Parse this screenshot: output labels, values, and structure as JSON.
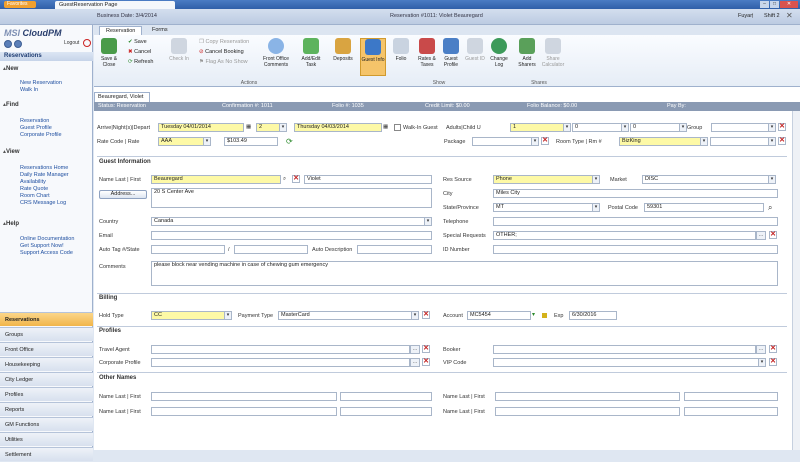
{
  "titlebar": {
    "favorites": "Favorites",
    "tab": "GuestReservation Page"
  },
  "header": {
    "business_date": "Business Date: 3/4/2014",
    "reservation_title": "Reservation #1011: Violet Beauregard",
    "user": "Fuyan",
    "shift": "Shift 2"
  },
  "sidebar": {
    "logo_a": "MSI",
    "logo_b": "CloudPM",
    "logout": "Logout",
    "panel_title": "Reservations",
    "sections": [
      {
        "title": "New",
        "items": [
          "New Reservation",
          "Walk In"
        ]
      },
      {
        "title": "Find",
        "items": [
          "Reservation",
          "Guest Profile",
          "Corporate Profile"
        ]
      },
      {
        "title": "View",
        "items": [
          "Reservations Home",
          "Daily Rate Manager",
          "Availability",
          "Rate Quote",
          "Room Chart",
          "CRS Message Log"
        ]
      },
      {
        "title": "Help",
        "items": [
          "Online Documentation",
          "Get Support Now!",
          "Support Access Code"
        ]
      }
    ],
    "bottom": [
      "Reservations",
      "Groups",
      "Front Office",
      "Housekeeping",
      "City Ledger",
      "Profiles",
      "Reports",
      "GM Functions",
      "Utilities",
      "Settlement"
    ]
  },
  "ribbon": {
    "tabs": [
      "Reservation",
      "Forms"
    ],
    "save_close": "Save & Close",
    "save": "Save",
    "cancel": "Cancel",
    "refresh": "Refresh",
    "check_in": "Check In",
    "copy_res": "Copy Reservation",
    "cancel_booking": "Cancel Booking",
    "flag_no_show": "Flag As No Show",
    "front_office_comments": "Front Office Comments",
    "add_edit_task": "Add/Edit Task",
    "deposits": "Deposits",
    "guest_info": "Guest Info",
    "folio": "Folio",
    "rates_taxes": "Rates & Taxes",
    "guest_profile": "Guest Profile",
    "guest_id": "Guest ID",
    "change_log": "Change Log",
    "add_sharers": "Add Sharers",
    "share_calculator": "Share Calculator",
    "groups": [
      "Actions",
      "Show",
      "Shares"
    ]
  },
  "doc_tab": "Beauregard, Violet",
  "status": {
    "status": "Status: Reservation",
    "confirmation": "Confirmation #: 1011",
    "folio": "Folio #: 1035",
    "credit_limit": "Credit Limit: $0.00",
    "folio_balance": "Folio Balance: $0.00",
    "pay_by": "Pay By:"
  },
  "stay": {
    "arrive_label": "Arrive|Night(s)|Depart",
    "arrive": "Tuesday 04/01/2014",
    "nights": "2",
    "depart": "Thursday 04/03/2014",
    "walkin_label": "Walk-In Guest",
    "adults_label": "Adults|Child U",
    "adults": "1",
    "child_a": "0",
    "child_b": "0",
    "group_label": "Group",
    "rate_label": "Rate Code | Rate",
    "rate_code": "AAA",
    "rate": "$103.49",
    "package_label": "Package",
    "room_label": "Room Type | Rm #",
    "room_type": "BizKing"
  },
  "guest": {
    "section": "Guest Information",
    "name_label": "Name  Last | First",
    "last": "Beauregard",
    "first": "Violet",
    "address_btn": "Address...",
    "address": "20 S Center Ave",
    "country_label": "Country",
    "country": "Canada",
    "email_label": "Email",
    "autotag_label": "Auto Tag #/State",
    "auto_desc_label": "Auto Description",
    "comments_label": "Comments",
    "comments": "please block near vending machine in case of chewing gum emergency",
    "res_source_label": "Res Source",
    "res_source": "Phone",
    "market_label": "Market",
    "market": "DISC",
    "city_label": "City",
    "city": "Miles City",
    "state_label": "State/Province",
    "state": "MT",
    "postal_label": "Postal Code",
    "postal": "59301",
    "telephone_label": "Telephone",
    "special_label": "Special Requests",
    "special": "OTHER;",
    "id_label": "ID Number"
  },
  "billing": {
    "section": "Billing",
    "hold_label": "Hold Type",
    "hold": "CC",
    "payment_label": "Payment Type",
    "payment": "MasterCard",
    "account_label": "Account",
    "account": "MC5454",
    "exp_label": "Exp",
    "exp": "6/30/2016"
  },
  "profiles": {
    "section": "Profiles",
    "travel_agent": "Travel Agent",
    "corporate": "Corporate Profile",
    "booker": "Booker",
    "vip": "VIP Code"
  },
  "other_names": {
    "section": "Other Names",
    "name_label": "Name  Last | First"
  }
}
